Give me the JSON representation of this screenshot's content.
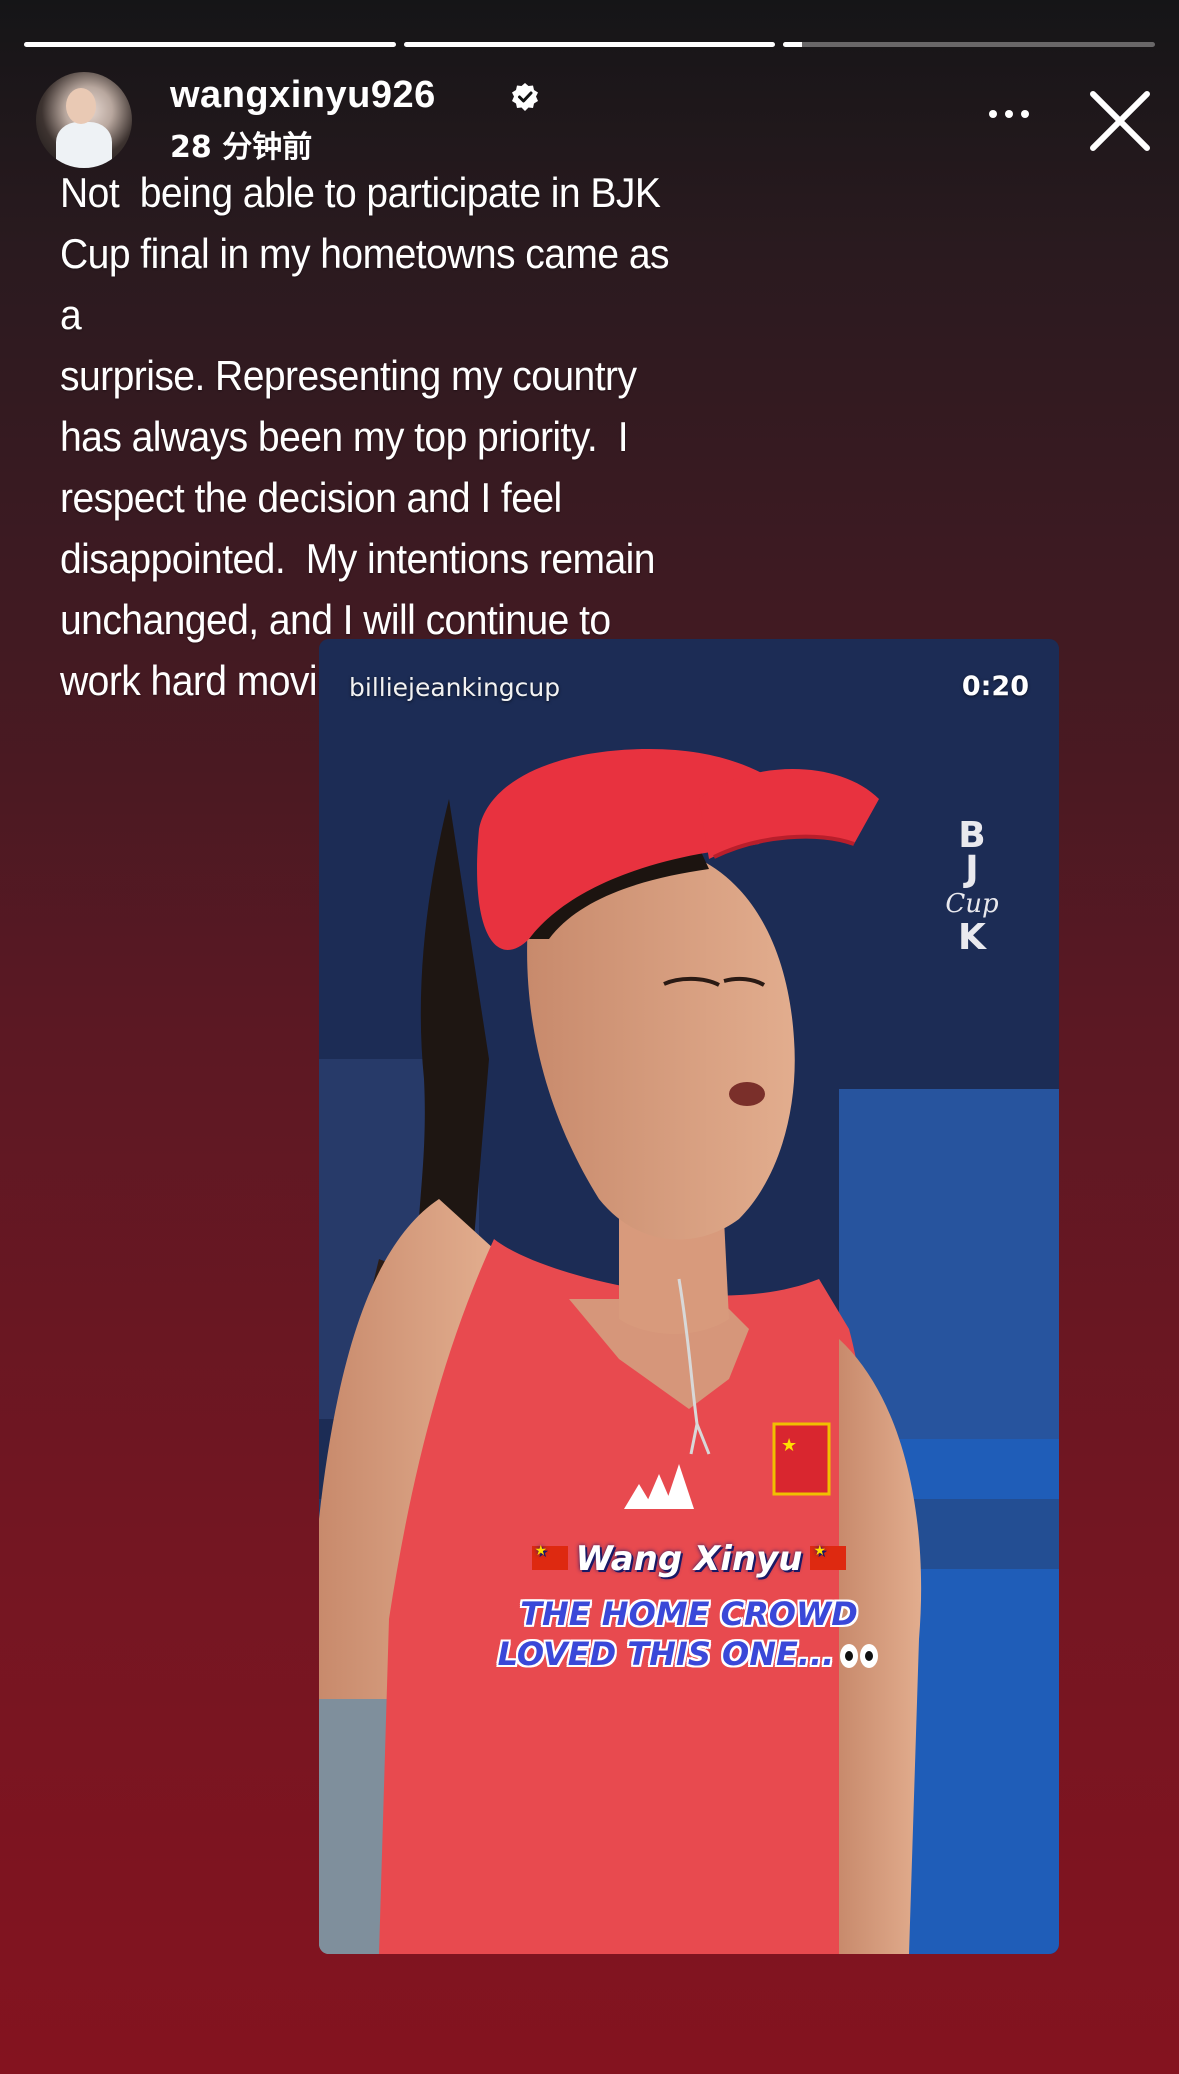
{
  "story": {
    "progress": [
      1,
      1,
      0.05
    ],
    "username": "wangxinyu926",
    "verified": true,
    "timestamp": "28 分钟前",
    "caption": "Not  being able to participate in BJK\nCup final in my hometowns came as a\nsurprise. Representing my country\nhas always been my top priority.  I\nrespect the decision and I feel\ndisappointed.  My intentions remain\nunchanged, and I will continue to\nwork hard moving forward."
  },
  "icons": {
    "more": "more-horizontal-icon",
    "close": "close-icon",
    "verified": "verified-badge-icon"
  },
  "video": {
    "channel": "billiejeankingcup",
    "duration": "0:20",
    "logo_letters": [
      "B",
      "J",
      "K"
    ],
    "logo_script": "Cup",
    "player_name": "Wang Xinyu",
    "tagline_line1": "THE HOME CROWD",
    "tagline_line2": "LOVED THIS ONE..."
  },
  "colors": {
    "visor": "#e8323f",
    "jersey": "#e84a4f",
    "tagline": "#3a48d8",
    "flag_red": "#de2910",
    "flag_star": "#ffde00"
  }
}
